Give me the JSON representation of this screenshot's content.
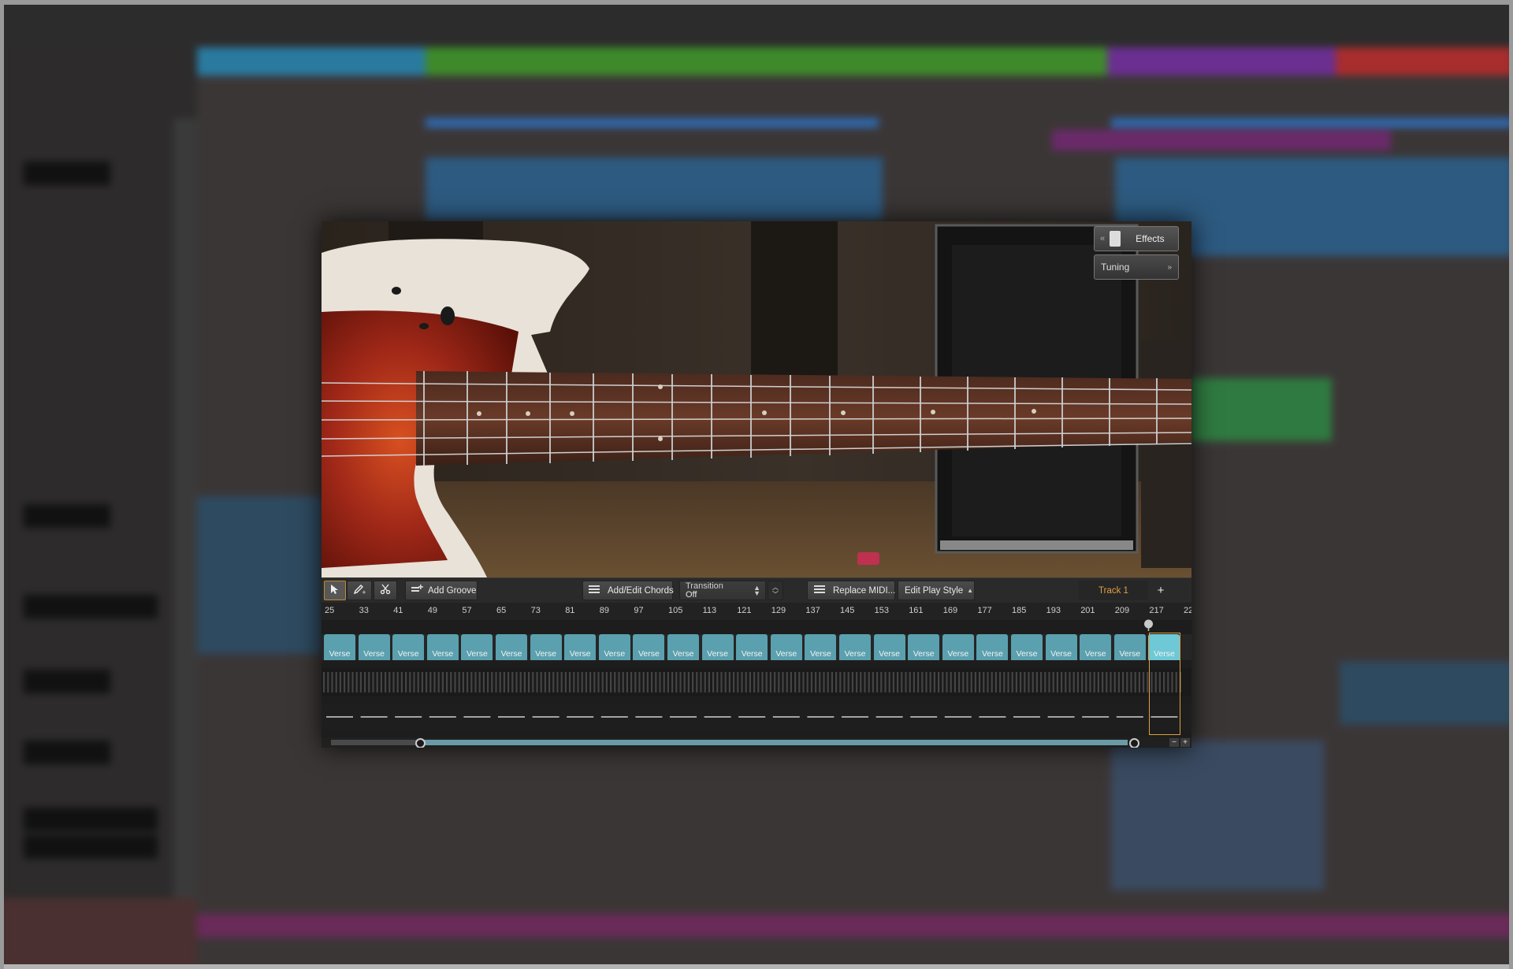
{
  "plugin": {
    "effects_label": "Effects",
    "tuning_label": "Tuning",
    "toolbar": {
      "add_groove": "Add Groove",
      "add_edit_chords": "Add/Edit Chords",
      "transition_label": "Transition",
      "transition_value": "Off",
      "replace_midi": "Replace MIDI...",
      "edit_play_style": "Edit Play Style",
      "track_name": "Track 1",
      "add_track": "+"
    },
    "ruler_ticks": [
      "25",
      "33",
      "41",
      "49",
      "57",
      "65",
      "73",
      "81",
      "89",
      "97",
      "105",
      "113",
      "121",
      "129",
      "137",
      "145",
      "153",
      "161",
      "169",
      "177",
      "185",
      "193",
      "201",
      "209",
      "217",
      "22"
    ],
    "sections": [
      "Verse",
      "Verse",
      "Verse",
      "Verse",
      "Verse",
      "Verse",
      "Verse",
      "Verse",
      "Verse",
      "Verse",
      "Verse",
      "Verse",
      "Verse",
      "Verse",
      "Verse",
      "Verse",
      "Verse",
      "Verse",
      "Verse",
      "Verse",
      "Verse",
      "Verse",
      "Verse",
      "Verse",
      "Verse"
    ],
    "active_section_index": 24,
    "zoom_out": "−",
    "zoom_in": "+"
  },
  "colors": {
    "accent_track": "#e0a040",
    "section_fill": "#5aa0ae",
    "section_active": "#6fc8d6",
    "arranger_green": "#4a8a2a",
    "arranger_purple": "#7a3aa0",
    "arranger_red": "#b03030",
    "arranger_teal": "#2a6a8a"
  }
}
